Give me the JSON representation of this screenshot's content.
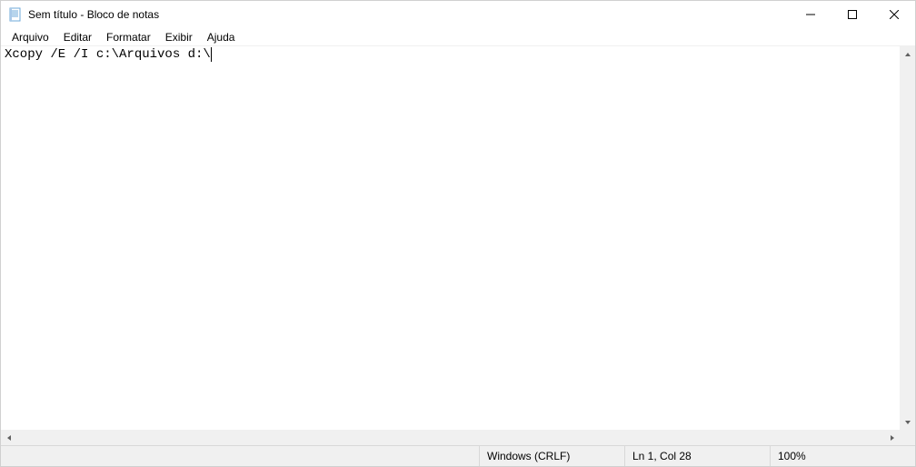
{
  "title": "Sem título - Bloco de notas",
  "menus": {
    "arquivo": "Arquivo",
    "editar": "Editar",
    "formatar": "Formatar",
    "exibir": "Exibir",
    "ajuda": "Ajuda"
  },
  "editor": {
    "content": "Xcopy /E /I c:\\Arquivos d:\\"
  },
  "status": {
    "eol": "Windows (CRLF)",
    "position": "Ln 1, Col 28",
    "zoom": "100%"
  }
}
